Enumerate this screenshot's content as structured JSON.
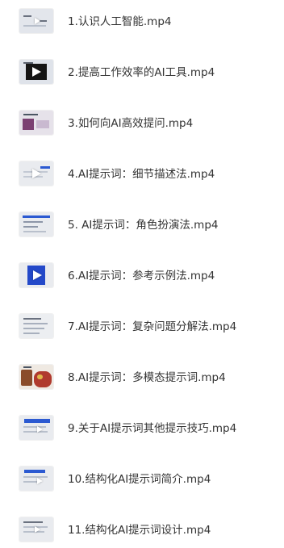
{
  "files": [
    {
      "name": "1.认识人工智能.mp4",
      "thumb_icon": "video-thumbnail-icon"
    },
    {
      "name": "2.提高工作效率的AI工具.mp4",
      "thumb_icon": "video-thumbnail-icon"
    },
    {
      "name": "3.如何向AI高效提问.mp4",
      "thumb_icon": "video-thumbnail-icon"
    },
    {
      "name": "4.AI提示词：细节描述法.mp4",
      "thumb_icon": "video-thumbnail-icon"
    },
    {
      "name": "5. AI提示词：角色扮演法.mp4",
      "thumb_icon": "video-thumbnail-icon"
    },
    {
      "name": "6.AI提示词：参考示例法.mp4",
      "thumb_icon": "video-thumbnail-icon"
    },
    {
      "name": "7.AI提示词：复杂问题分解法.mp4",
      "thumb_icon": "video-thumbnail-icon"
    },
    {
      "name": "8.AI提示词：多模态提示词.mp4",
      "thumb_icon": "video-thumbnail-icon"
    },
    {
      "name": "9.关于AI提示词其他提示技巧.mp4",
      "thumb_icon": "video-thumbnail-icon"
    },
    {
      "name": "10.结构化AI提示词简介.mp4",
      "thumb_icon": "video-thumbnail-icon"
    },
    {
      "name": "11.结构化AI提示词设计.mp4",
      "thumb_icon": "video-thumbnail-icon"
    }
  ]
}
